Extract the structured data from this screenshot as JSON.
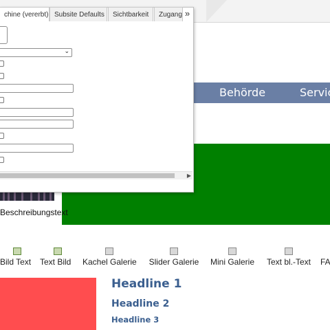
{
  "panel": {
    "tabs": [
      {
        "label": "chine (vererbt)",
        "active": true
      },
      {
        "label": "Subsite Defaults",
        "active": false
      },
      {
        "label": "Sichtbarkeit",
        "active": false
      },
      {
        "label": "Zugang",
        "active": false
      }
    ],
    "more_glyph": "»"
  },
  "nav": {
    "items": [
      "Behörde",
      "Servic"
    ],
    "color": "#6a7fa5"
  },
  "teaser": {
    "caption": "Beschreibungstext",
    "background": "#008000"
  },
  "widgets": [
    {
      "label": "Bild Text",
      "icon": "image-icon"
    },
    {
      "label": "Text Bild",
      "icon": "image-icon"
    },
    {
      "label": "Kachel Galerie",
      "icon": "gallery-icon"
    },
    {
      "label": "Slider Galerie",
      "icon": "gallery-icon"
    },
    {
      "label": "Mini Galerie",
      "icon": "gallery-icon"
    },
    {
      "label": "Text bl.-Text",
      "icon": "calendar-icon"
    },
    {
      "label": "FA",
      "icon": "gallery-icon"
    }
  ],
  "headlines": {
    "h1": "Headline 1",
    "h2": "Headline 2",
    "h3": "Headline 3",
    "color": "#3b5f8f"
  }
}
